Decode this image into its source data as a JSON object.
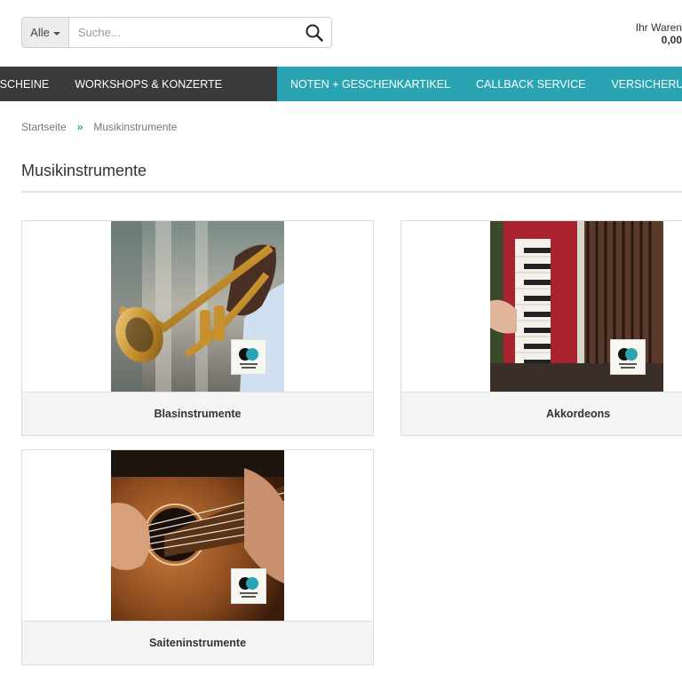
{
  "search": {
    "category": "Alle",
    "placeholder": "Suche..."
  },
  "cart": {
    "label": "Ihr Waren",
    "amount": "0,00"
  },
  "nav": {
    "dark_items": [
      "TSCHEINE",
      "WORKSHOPS & KONZERTE"
    ],
    "teal_items": [
      "NOTEN + GESCHENKARTIKEL",
      "CALLBACK SERVICE",
      "VERSICHERUNG"
    ]
  },
  "breadcrumb": {
    "home": "Startseite",
    "separator": "»",
    "current": "Musikinstrumente"
  },
  "page": {
    "title": "Musikinstrumente"
  },
  "categories": [
    {
      "name": "Blasinstrumente",
      "image": "trumpet-photo"
    },
    {
      "name": "Akkordeons",
      "image": "accordion-photo"
    },
    {
      "name": "Saiteninstrumente",
      "image": "guitar-photo"
    }
  ],
  "colors": {
    "nav_dark": "#3a3a3a",
    "nav_teal": "#2aa4b3",
    "card_label_bg": "#f4f4f4"
  }
}
